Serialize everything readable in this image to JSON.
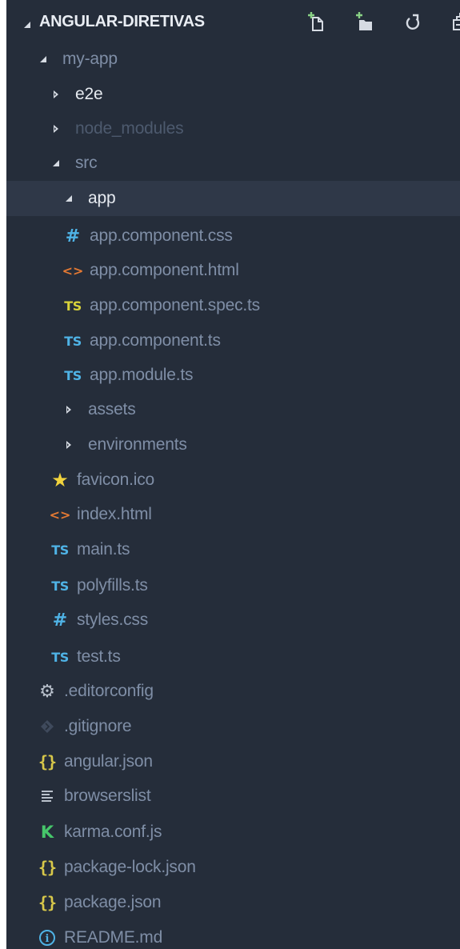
{
  "explorer": {
    "title": "ANGULAR-DIRETIVAS",
    "actions": [
      {
        "name": "new-file-icon"
      },
      {
        "name": "new-folder-icon"
      },
      {
        "name": "refresh-icon"
      },
      {
        "name": "collapse-all-icon"
      }
    ]
  },
  "tree": [
    {
      "label": "my-app",
      "kind": "folder-open",
      "icon": "chevron-open",
      "tone": "normal"
    },
    {
      "label": "e2e",
      "kind": "folder-closed",
      "icon": "chevron-closed",
      "tone": "bright"
    },
    {
      "label": "node_modules",
      "kind": "folder-closed",
      "icon": "chevron-closed",
      "tone": "dim"
    },
    {
      "label": "src",
      "kind": "folder-open",
      "icon": "chevron-open",
      "tone": "normal"
    },
    {
      "label": "app",
      "kind": "folder-open",
      "icon": "chevron-open",
      "tone": "bright",
      "selected": true
    },
    {
      "label": "app.component.css",
      "kind": "file",
      "icon": "css-hash-icon",
      "tone": "normal"
    },
    {
      "label": "app.component.html",
      "kind": "file",
      "icon": "html-code-icon",
      "tone": "normal"
    },
    {
      "label": "app.component.spec.ts",
      "kind": "file",
      "icon": "typescript-spec-icon",
      "tone": "normal"
    },
    {
      "label": "app.component.ts",
      "kind": "file",
      "icon": "typescript-icon",
      "tone": "normal"
    },
    {
      "label": "app.module.ts",
      "kind": "file",
      "icon": "typescript-icon",
      "tone": "normal"
    },
    {
      "label": "assets",
      "kind": "folder-closed",
      "icon": "chevron-closed",
      "tone": "normal"
    },
    {
      "label": "environments",
      "kind": "folder-closed",
      "icon": "chevron-closed",
      "tone": "normal"
    },
    {
      "label": "favicon.ico",
      "kind": "file",
      "icon": "star-icon",
      "tone": "normal"
    },
    {
      "label": "index.html",
      "kind": "file",
      "icon": "html-code-icon",
      "tone": "normal"
    },
    {
      "label": "main.ts",
      "kind": "file",
      "icon": "typescript-icon",
      "tone": "normal"
    },
    {
      "label": "polyfills.ts",
      "kind": "file",
      "icon": "typescript-icon",
      "tone": "normal"
    },
    {
      "label": "styles.css",
      "kind": "file",
      "icon": "css-hash-icon",
      "tone": "normal"
    },
    {
      "label": "test.ts",
      "kind": "file",
      "icon": "typescript-icon",
      "tone": "normal"
    },
    {
      "label": ".editorconfig",
      "kind": "file",
      "icon": "gear-icon",
      "tone": "normal"
    },
    {
      "label": ".gitignore",
      "kind": "file",
      "icon": "git-icon",
      "tone": "normal"
    },
    {
      "label": "angular.json",
      "kind": "file",
      "icon": "json-braces-icon",
      "tone": "normal"
    },
    {
      "label": "browserslist",
      "kind": "file",
      "icon": "text-lines-icon",
      "tone": "normal"
    },
    {
      "label": "karma.conf.js",
      "kind": "file",
      "icon": "karma-icon",
      "tone": "normal"
    },
    {
      "label": "package-lock.json",
      "kind": "file",
      "icon": "json-braces-icon",
      "tone": "normal"
    },
    {
      "label": "package.json",
      "kind": "file",
      "icon": "json-braces-icon",
      "tone": "normal"
    },
    {
      "label": "README.md",
      "kind": "file",
      "icon": "info-icon",
      "tone": "normal"
    }
  ],
  "icon_glyphs": {
    "ts": "TS",
    "hash": "#",
    "code": "<>",
    "braces": "{}",
    "karma": "K",
    "star": "★",
    "gear": "⚙",
    "info": "i"
  },
  "colors": {
    "background": "#252d3a",
    "selected_row": "#2f3848",
    "text": "#7f8ea6",
    "text_bright": "#e6eaf0",
    "text_dim": "#4d5a6e",
    "typescript": "#4fb3e6",
    "typescript_spec": "#d8d23a",
    "css": "#4fb3e6",
    "html": "#e37933",
    "json": "#d8c84a",
    "star": "#f1d33d",
    "karma": "#46c66a"
  }
}
